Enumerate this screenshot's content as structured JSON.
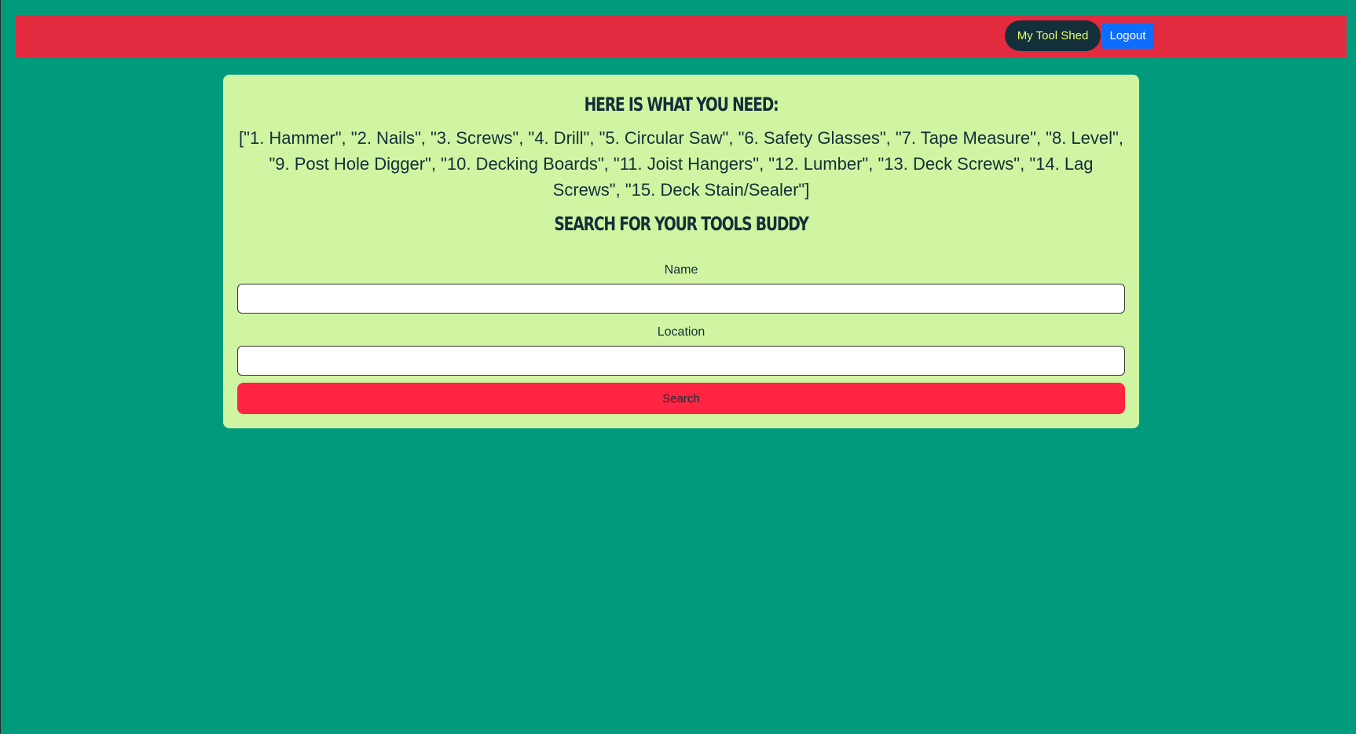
{
  "nav": {
    "tool_shed_label": "My Tool Shed",
    "logout_label": "Logout"
  },
  "card": {
    "needs_heading": "Here is what you need:",
    "tool_list": "[\"1. Hammer\", \"2. Nails\", \"3. Screws\", \"4. Drill\", \"5. Circular Saw\", \"6. Safety Glasses\", \"7. Tape Measure\", \"8. Level\", \"9. Post Hole Digger\", \"10. Decking Boards\", \"11. Joist Hangers\", \"12. Lumber\", \"13. Deck Screws\", \"14. Lag Screws\", \"15. Deck Stain/Sealer\"]",
    "search_heading": "Search for your tools buddy"
  },
  "form": {
    "name_label": "Name",
    "name_value": "",
    "location_label": "Location",
    "location_value": "",
    "search_button_label": "Search"
  },
  "colors": {
    "page_background": "#009b7d",
    "navbar": "#e32b40",
    "card": "#d0f5a2",
    "tool_shed_button": "#132f3a",
    "tool_shed_text": "#e7ff6a",
    "logout_button": "#0d6efd",
    "search_button": "#ff2441",
    "text_dark": "#132f3a"
  }
}
